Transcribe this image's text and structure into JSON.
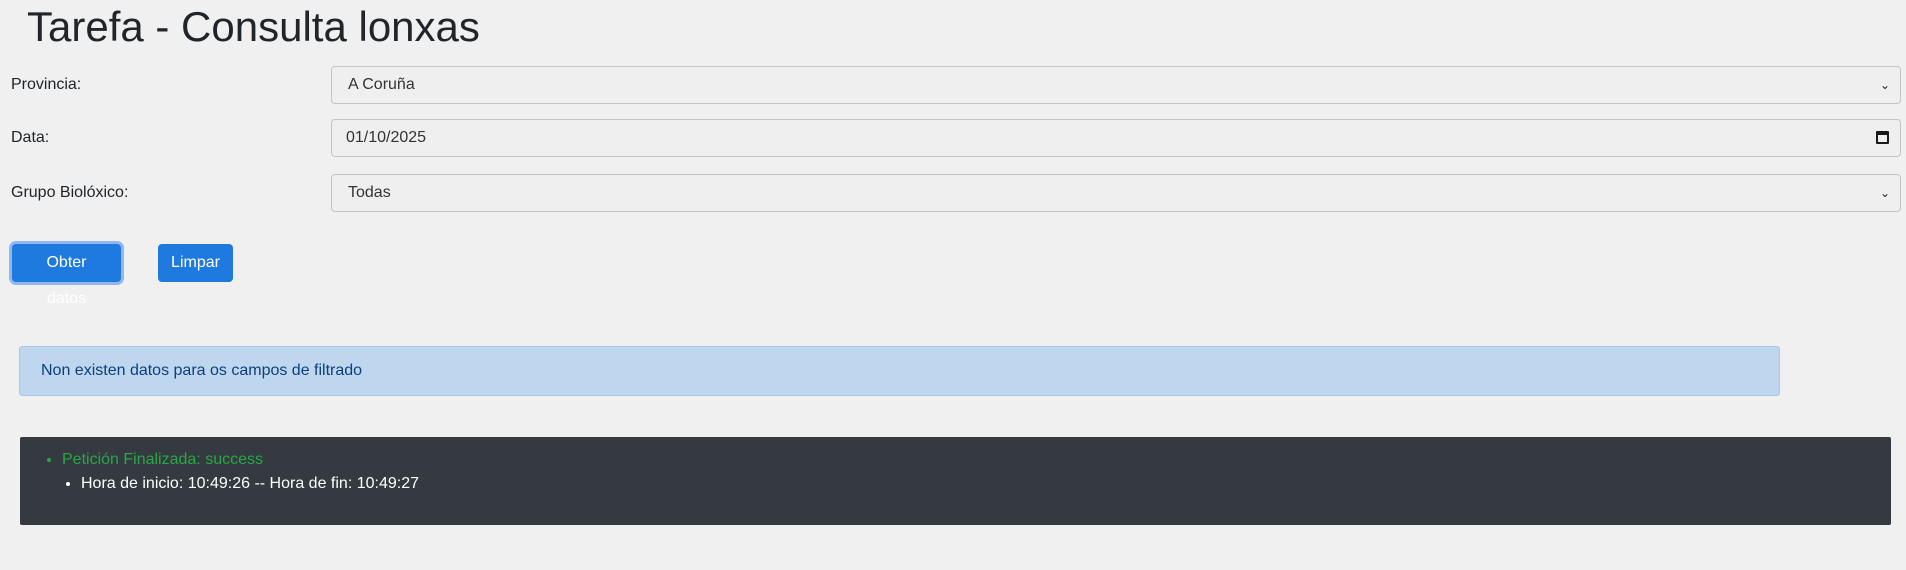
{
  "page": {
    "title": "Tarefa - Consulta lonxas"
  },
  "form": {
    "provincia": {
      "label": "Provincia:",
      "selected": "A Coruña"
    },
    "data": {
      "label": "Data:",
      "value": "01/10/2025"
    },
    "grupo": {
      "label": "Grupo Biolóxico:",
      "selected": "Todas"
    }
  },
  "buttons": {
    "obter_label": "Obter datos",
    "limpar_label": "Limpar"
  },
  "alert": {
    "message": "Non existen datos para os campos de filtrado"
  },
  "log": {
    "status": "Petición Finalizada: success",
    "detail": "Hora de inicio: 10:49:26 -- Hora de fin: 10:49:27"
  },
  "icons": {
    "select_chevron": "chevron-down-icon",
    "date_picker": "calendar-icon"
  },
  "colors": {
    "primary": "#1f7ae0",
    "alert_bg": "#bed7ee",
    "alert_text": "#0b3f7d",
    "log_bg": "#343a40",
    "success": "#28a745"
  }
}
